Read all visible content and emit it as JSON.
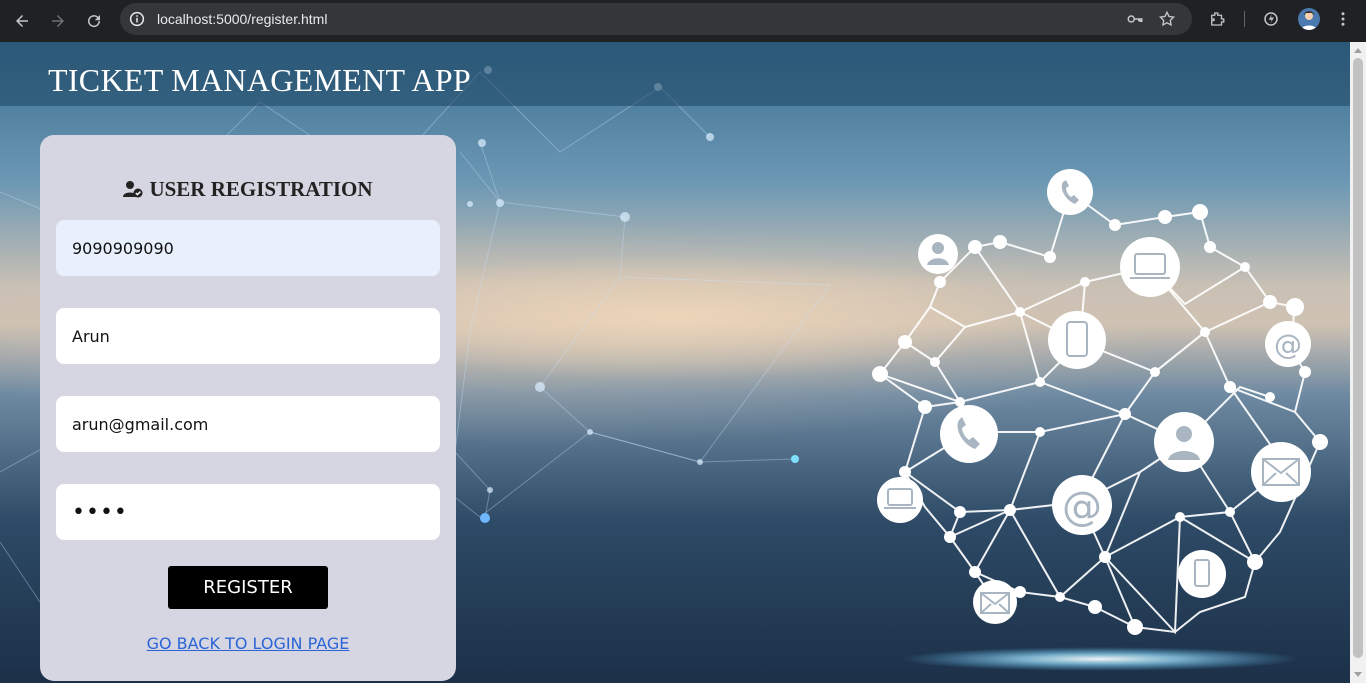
{
  "browser": {
    "url_host": "localhost",
    "url_rest": ":5000/register.html"
  },
  "app": {
    "title": "TICKET MANAGEMENT APP"
  },
  "form": {
    "heading": "USER REGISTRATION",
    "fields": [
      {
        "name": "phone",
        "value": "9090909090"
      },
      {
        "name": "username",
        "value": "Arun"
      },
      {
        "name": "email",
        "value": "arun@gmail.com"
      },
      {
        "name": "password",
        "value": "••••"
      }
    ],
    "register_label": "REGISTER",
    "back_link": "GO BACK TO LOGIN PAGE"
  },
  "colors": {
    "card_bg": "#d6d6e2",
    "button_bg": "#000000",
    "link": "#2a64d6",
    "autofill_bg": "#e8f0fe"
  }
}
